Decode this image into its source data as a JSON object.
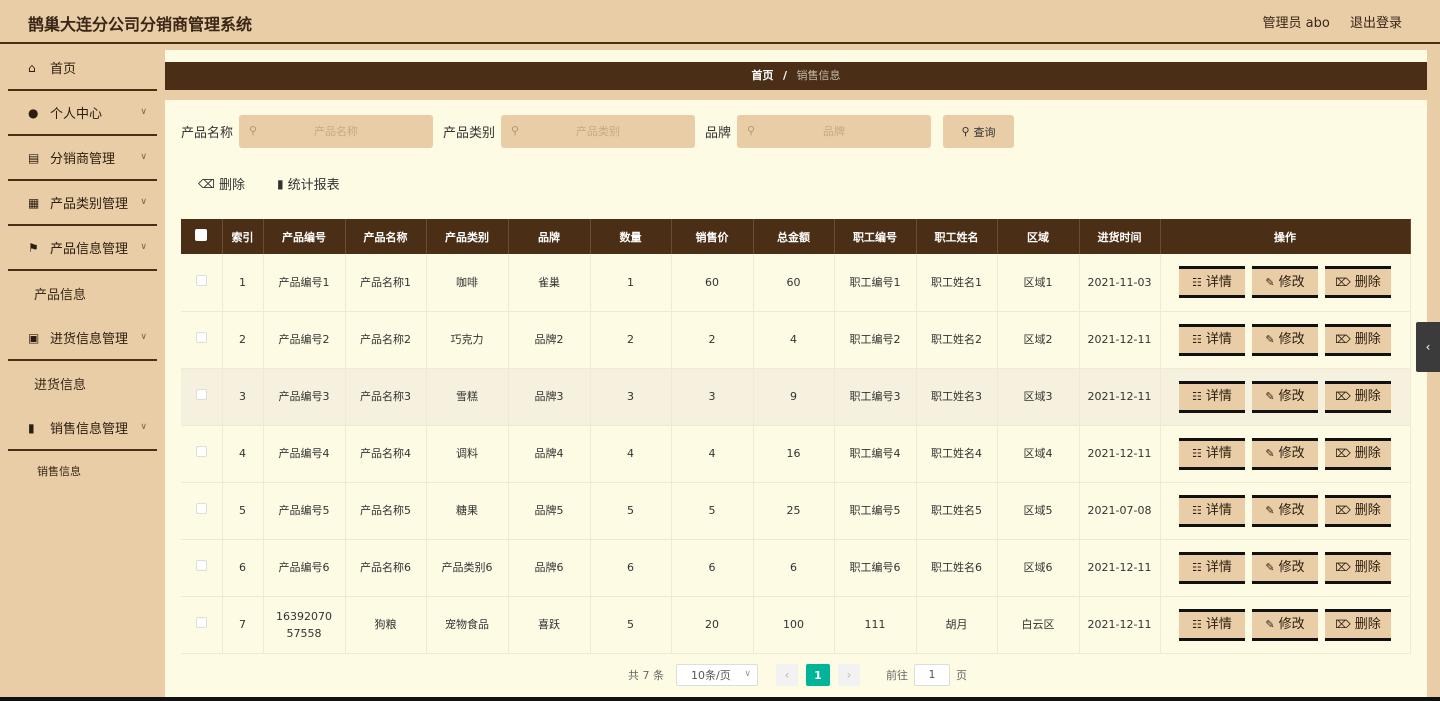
{
  "app": {
    "title": "鹊巢大连分公司分销商管理系统"
  },
  "header": {
    "user": "管理员 abo",
    "logout": "退出登录"
  },
  "sidebar": {
    "items": [
      {
        "label": "首页",
        "icon": "home-icon"
      },
      {
        "label": "个人中心",
        "icon": "user-icon"
      },
      {
        "label": "分销商管理",
        "icon": "store-icon"
      },
      {
        "label": "产品类别管理",
        "icon": "grid-icon"
      },
      {
        "label": "产品信息管理",
        "icon": "flag-icon"
      },
      {
        "label": "产品信息"
      },
      {
        "label": "进货信息管理",
        "icon": "chart-box-icon"
      },
      {
        "label": "进货信息"
      },
      {
        "label": "销售信息管理",
        "icon": "bar-chart-icon"
      },
      {
        "label": "销售信息"
      }
    ]
  },
  "breadcrumb": {
    "home": "首页",
    "sep": "/",
    "current": "销售信息"
  },
  "filters": {
    "product_name": {
      "label": "产品名称",
      "placeholder": "产品名称"
    },
    "product_type": {
      "label": "产品类别",
      "placeholder": "产品类别"
    },
    "brand": {
      "label": "品牌",
      "placeholder": "品牌"
    },
    "query": "查询"
  },
  "toolbar": {
    "delete": "删除",
    "report": "统计报表"
  },
  "table": {
    "headers": [
      "索引",
      "产品编号",
      "产品名称",
      "产品类别",
      "品牌",
      "数量",
      "销售价",
      "总金额",
      "职工编号",
      "职工姓名",
      "区域",
      "进货时间",
      "操作"
    ],
    "rows": [
      [
        "1",
        "产品编号1",
        "产品名称1",
        "咖啡",
        "雀巢",
        "1",
        "60",
        "60",
        "职工编号1",
        "职工姓名1",
        "区域1",
        "2021-11-03"
      ],
      [
        "2",
        "产品编号2",
        "产品名称2",
        "巧克力",
        "品牌2",
        "2",
        "2",
        "4",
        "职工编号2",
        "职工姓名2",
        "区域2",
        "2021-12-11"
      ],
      [
        "3",
        "产品编号3",
        "产品名称3",
        "雪糕",
        "品牌3",
        "3",
        "3",
        "9",
        "职工编号3",
        "职工姓名3",
        "区域3",
        "2021-12-11"
      ],
      [
        "4",
        "产品编号4",
        "产品名称4",
        "调料",
        "品牌4",
        "4",
        "4",
        "16",
        "职工编号4",
        "职工姓名4",
        "区域4",
        "2021-12-11"
      ],
      [
        "5",
        "产品编号5",
        "产品名称5",
        "糖果",
        "品牌5",
        "5",
        "5",
        "25",
        "职工编号5",
        "职工姓名5",
        "区域5",
        "2021-07-08"
      ],
      [
        "6",
        "产品编号6",
        "产品名称6",
        "产品类别6",
        "品牌6",
        "6",
        "6",
        "6",
        "职工编号6",
        "职工姓名6",
        "区域6",
        "2021-12-11"
      ],
      [
        "7",
        "1639207057558",
        "狗粮",
        "宠物食品",
        "喜跃",
        "5",
        "20",
        "100",
        "111",
        "胡月",
        "白云区",
        "2021-12-11"
      ]
    ],
    "actions": {
      "detail": "详情",
      "edit": "修改",
      "delete": "删除"
    }
  },
  "pagination": {
    "total": "共 7 条",
    "page_size": "10条/页",
    "current_page": "1",
    "goto_label": "前往",
    "goto_value": "1",
    "page_suffix": "页"
  }
}
